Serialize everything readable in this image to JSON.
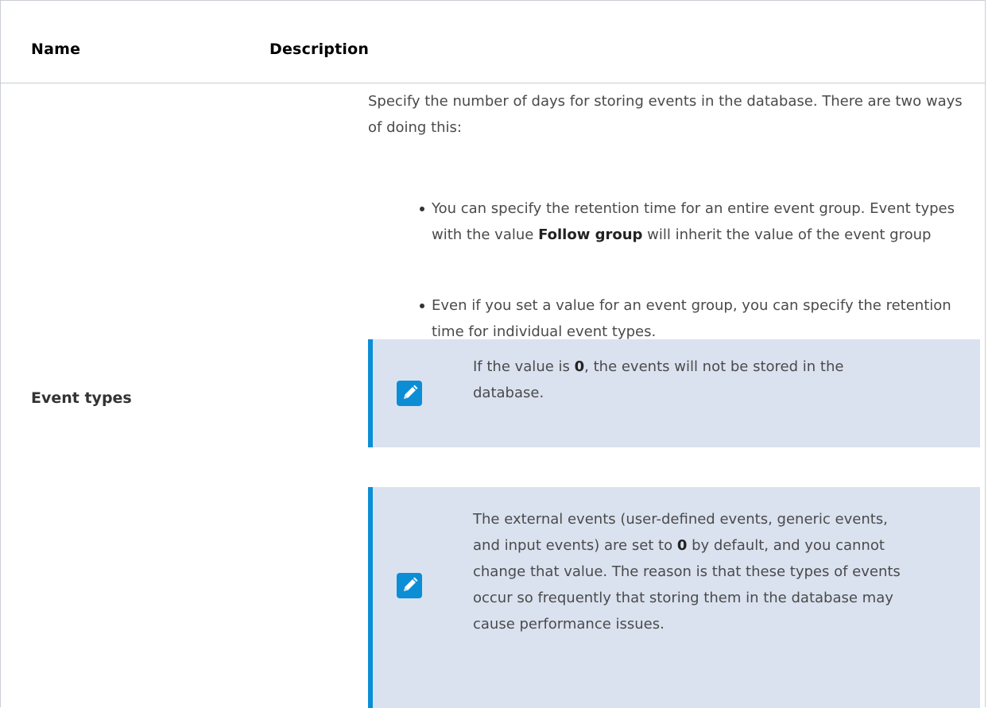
{
  "table": {
    "headers": {
      "name": "Name",
      "description": "Description"
    },
    "rows": [
      {
        "name": "Event types",
        "description": {
          "intro": "Specify the number of days for storing events in the database. There are two ways of doing this:",
          "bullets": [
            {
              "before": "You can specify the retention time for an entire event group. Event types with the value ",
              "bold": "Follow group",
              "after": " will inherit the value of the event group"
            },
            {
              "text": "Even if you set a value for an event group, you can specify the retention time for individual event types."
            }
          ],
          "notes": [
            {
              "icon": "pencil-icon",
              "before": "If the value is ",
              "bold": "0",
              "after": ", the events will not be stored in the database."
            },
            {
              "icon": "pencil-icon",
              "before": "The external events (user-defined events, generic events, and input events) are set to ",
              "bold": "0",
              "after": " by default, and you cannot change that value. The reason is that these types of events occur so frequently that storing them in the database may cause performance issues."
            }
          ]
        }
      }
    ]
  },
  "colors": {
    "note_background": "#dae2f0",
    "note_accent": "#0b8ed6",
    "border": "#c9cdd3"
  }
}
